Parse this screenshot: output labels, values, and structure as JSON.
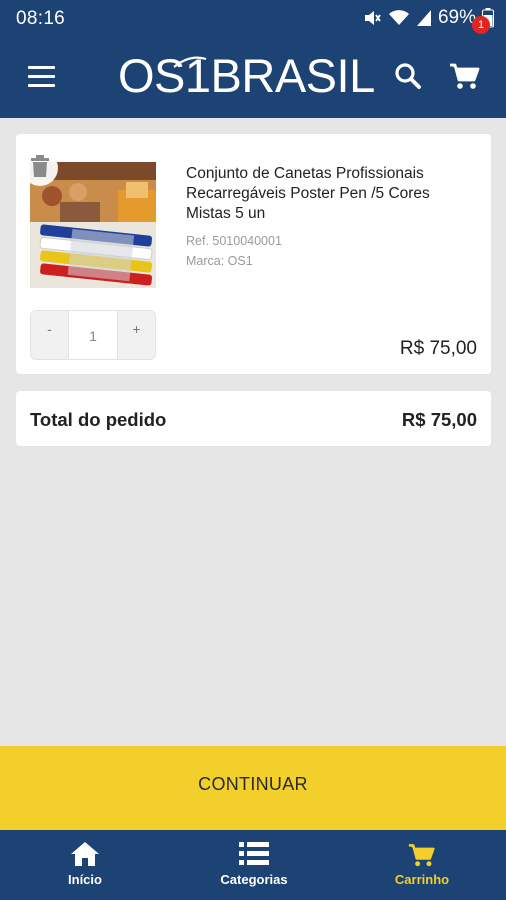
{
  "status_bar": {
    "time": "08:16",
    "battery": "69%",
    "icons": [
      "mute-icon",
      "wifi-icon",
      "signal-icon",
      "battery-icon"
    ]
  },
  "header": {
    "logo_text": "OS1BRASIL",
    "menu_icon": "hamburger-menu-icon",
    "search_icon": "search-icon",
    "cart_icon": "cart-icon",
    "cart_count": "1"
  },
  "cart": {
    "items": [
      {
        "title": "Conjunto de Canetas Profissionais Recarregáveis Poster Pen /5 Cores Mistas 5 un",
        "ref": "Ref. 5010040001",
        "brand": "Marca: OS1",
        "quantity": "1",
        "decrement_label": "-",
        "increment_label": "+",
        "price": "R$ 75,00"
      }
    ],
    "total_label": "Total do pedido",
    "total_value": "R$ 75,00"
  },
  "actions": {
    "continue_label": "CONTINUAR"
  },
  "bottom_nav": {
    "items": [
      {
        "label": "Início",
        "icon": "home-icon",
        "active": false
      },
      {
        "label": "Categorias",
        "icon": "list-icon",
        "active": false
      },
      {
        "label": "Carrinho",
        "icon": "cart-icon",
        "active": true
      }
    ]
  },
  "colors": {
    "primary_navy": "#1d4274",
    "accent_yellow": "#f2cf2a",
    "badge_red": "#e32420",
    "background": "#e6e6e6"
  }
}
